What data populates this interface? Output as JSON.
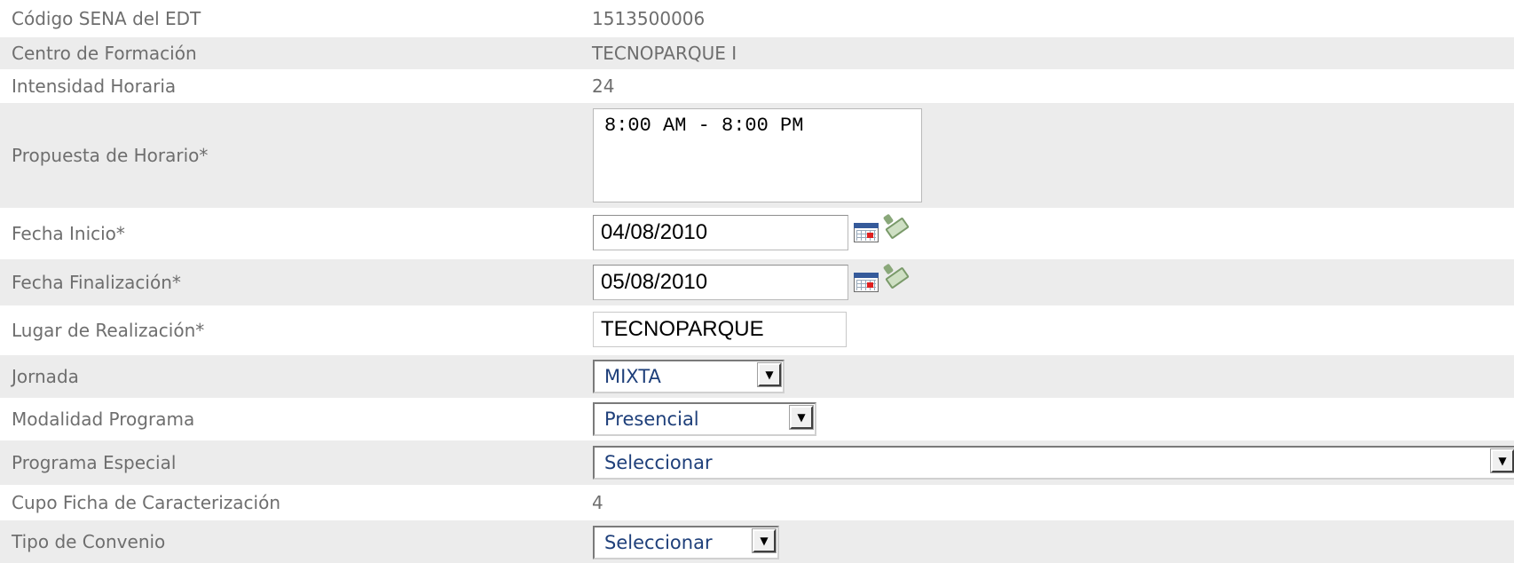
{
  "form": {
    "codigo": {
      "label": "Código SENA del EDT",
      "value": "1513500006"
    },
    "centro": {
      "label": "Centro de Formación",
      "value": "TECNOPARQUE I"
    },
    "intensidad": {
      "label": "Intensidad Horaria",
      "value": "24"
    },
    "horario": {
      "label": "Propuesta de Horario*",
      "value": "8:00 AM - 8:00 PM"
    },
    "fecha_inicio": {
      "label": "Fecha Inicio*",
      "value": "04/08/2010",
      "calendar_icon": "calendar-icon",
      "clear_icon": "eraser-icon"
    },
    "fecha_fin": {
      "label": "Fecha Finalización*",
      "value": "05/08/2010",
      "calendar_icon": "calendar-icon",
      "clear_icon": "eraser-icon"
    },
    "lugar": {
      "label": "Lugar de Realización*",
      "value": "TECNOPARQUE"
    },
    "jornada": {
      "label": "Jornada",
      "selected": "MIXTA"
    },
    "modalidad": {
      "label": "Modalidad Programa",
      "selected": "Presencial"
    },
    "programa_especial": {
      "label": "Programa Especial",
      "selected": "Seleccionar"
    },
    "cupo": {
      "label": "Cupo Ficha de Caracterización",
      "value": "4"
    },
    "convenio": {
      "label": "Tipo de Convenio",
      "selected": "Seleccionar"
    }
  },
  "colors": {
    "row_shade": "#ececec",
    "label_text": "#6e6e6e",
    "select_text": "#1e3f7a"
  }
}
